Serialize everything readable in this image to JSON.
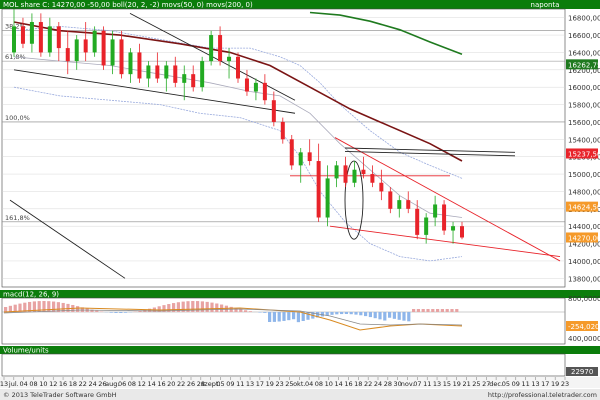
{
  "chart_data": {
    "type": "candlestick",
    "colors": {
      "up_candle": "#22aa22",
      "down_candle": "#e8232a",
      "sma50": "#7a1414",
      "sma200": "#1f7a1f",
      "bollinger": "#9ad",
      "trendline": "#e8232a",
      "grid": "#cfcfcf",
      "title_bar": "#0b7d0b",
      "price_tag_green": "#1f7a1f",
      "price_tag_red": "#e8232a",
      "price_tag_orange": "#f59a2a",
      "macd_positive": "#e8a3a3",
      "macd_negative": "#8fb6ea"
    },
    "main_panel": {
      "legend_text": "MOL share C: 14270,00 -50,00 boll(20, 2, -2) movs(50, 0) movs(200, 0)",
      "period_label": "naponta",
      "y_ticks": [
        "16800,00",
        "16600,00",
        "16400,00",
        "16200,00",
        "16000,00",
        "15800,00",
        "15600,00",
        "15400,00",
        "15200,00",
        "15000,00",
        "14800,00",
        "14600,00",
        "14400,00",
        "14200,00",
        "14000,00",
        "13800,00"
      ],
      "ylim": [
        13700,
        16900
      ],
      "fib_levels": [
        {
          "label": "38,2%",
          "price": 16650
        },
        {
          "label": "61,8%",
          "price": 16300
        },
        {
          "label": "100,0%",
          "price": 15600
        },
        {
          "label": "161,8%",
          "price": 14450
        }
      ],
      "price_tags": [
        {
          "value": "16262,75",
          "color": "green",
          "price": 16263
        },
        {
          "value": "15237,50",
          "color": "red",
          "price": 15237
        },
        {
          "value": "14624,50",
          "color": "orange",
          "price": 14625
        },
        {
          "value": "14270,00",
          "color": "orange",
          "price": 14270
        }
      ],
      "candles": [
        [
          16400,
          16900,
          16350,
          16700
        ],
        [
          16700,
          16800,
          16450,
          16500
        ],
        [
          16500,
          16850,
          16400,
          16750
        ],
        [
          16750,
          16850,
          16350,
          16400
        ],
        [
          16400,
          16800,
          16350,
          16700
        ],
        [
          16700,
          16750,
          16300,
          16450
        ],
        [
          16450,
          16650,
          16150,
          16300
        ],
        [
          16300,
          16600,
          16200,
          16550
        ],
        [
          16550,
          16750,
          16300,
          16400
        ],
        [
          16400,
          16700,
          16350,
          16650
        ],
        [
          16650,
          16700,
          16200,
          16250
        ],
        [
          16250,
          16650,
          16150,
          16550
        ],
        [
          16550,
          16650,
          16100,
          16150
        ],
        [
          16150,
          16450,
          16050,
          16400
        ],
        [
          16400,
          16500,
          16050,
          16100
        ],
        [
          16100,
          16300,
          16000,
          16250
        ],
        [
          16250,
          16400,
          16050,
          16100
        ],
        [
          16100,
          16300,
          15950,
          16250
        ],
        [
          16250,
          16350,
          16000,
          16050
        ],
        [
          16050,
          16250,
          15850,
          16150
        ],
        [
          16150,
          16250,
          15950,
          16000
        ],
        [
          16000,
          16350,
          15950,
          16300
        ],
        [
          16300,
          16650,
          16250,
          16600
        ],
        [
          16600,
          16700,
          16250,
          16300
        ],
        [
          16300,
          16450,
          16100,
          16350
        ],
        [
          16350,
          16400,
          16050,
          16100
        ],
        [
          16100,
          16200,
          15900,
          15950
        ],
        [
          15950,
          16100,
          15850,
          16050
        ],
        [
          16050,
          16150,
          15800,
          15850
        ],
        [
          15850,
          15950,
          15550,
          15600
        ],
        [
          15600,
          15650,
          15350,
          15400
        ],
        [
          15400,
          15450,
          15050,
          15100
        ],
        [
          15100,
          15300,
          14900,
          15250
        ],
        [
          15250,
          15400,
          15100,
          15150
        ],
        [
          15150,
          15350,
          14450,
          14500
        ],
        [
          14500,
          15100,
          14400,
          14950
        ],
        [
          14950,
          15150,
          14850,
          15100
        ],
        [
          15100,
          15200,
          14850,
          14900
        ],
        [
          14900,
          15150,
          14850,
          15050
        ],
        [
          15050,
          15200,
          14950,
          15000
        ],
        [
          15000,
          15100,
          14850,
          14900
        ],
        [
          14900,
          15050,
          14700,
          14800
        ],
        [
          14800,
          14850,
          14550,
          14600
        ],
        [
          14600,
          14750,
          14500,
          14700
        ],
        [
          14700,
          14800,
          14550,
          14600
        ],
        [
          14600,
          14700,
          14250,
          14300
        ],
        [
          14300,
          14550,
          14200,
          14500
        ],
        [
          14500,
          14750,
          14400,
          14650
        ],
        [
          14650,
          14700,
          14300,
          14350
        ],
        [
          14350,
          14450,
          14200,
          14400
        ],
        [
          14400,
          14450,
          14250,
          14270
        ]
      ]
    },
    "macd_panel": {
      "label": "macd(12, 26, 9)",
      "y_ticks": [
        "800,0000",
        "400,0000"
      ],
      "value_tag": "-254,0200"
    },
    "volume_panel": {
      "label": "Volume/units",
      "value_tag": "22970"
    },
    "x_axis": {
      "labels": [
        "13",
        "jul.",
        "04",
        "08",
        "10",
        "12",
        "16",
        "18",
        "22",
        "24",
        "26",
        "aug.",
        "06",
        "08",
        "12",
        "14",
        "16",
        "20",
        "22",
        "26",
        "28",
        "szept.",
        "05",
        "09",
        "11",
        "13",
        "17",
        "19",
        "23",
        "25",
        "okt.",
        "04",
        "08",
        "10",
        "14",
        "16",
        "18",
        "22",
        "24",
        "28",
        "30",
        "nov.",
        "07",
        "11",
        "13",
        "15",
        "19",
        "21",
        "25",
        "27",
        "dec.",
        "05",
        "09",
        "11",
        "13",
        "17",
        "19",
        "23"
      ]
    },
    "footer": {
      "copyright": "© 2013 TeleTrader Software GmbH",
      "url": "http://professional.teletrader.com"
    }
  }
}
